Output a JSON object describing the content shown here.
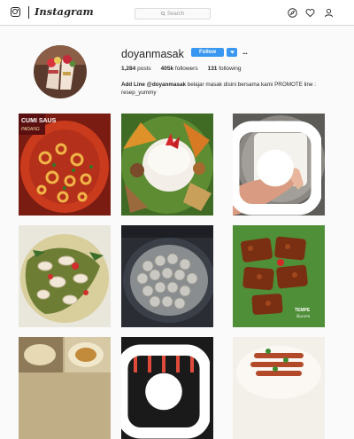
{
  "topbar": {
    "brand": "Instagram",
    "search_placeholder": "Search"
  },
  "profile": {
    "username": "doyanmasak",
    "follow_label": "Follow",
    "more_label": "...",
    "stats": {
      "posts_count": "1,284",
      "posts_label": "posts",
      "followers_count": "405k",
      "followers_label": "followers",
      "following_count": "131",
      "following_label": "following"
    },
    "bio_name": "Add Line @doyanmasak",
    "bio_text": "belajar masak disini bersama kami PROMOTE line : resep_yummy"
  },
  "posts": {
    "tile_1_caption": "CUMI SAUS",
    "tile_1_caption_2": "PADANG",
    "tile_6_caption": "TEMPE",
    "tile_6_caption_2": "Bacem"
  },
  "colors": {
    "accent": "#3897f0",
    "border": "#dbdbdb",
    "background": "#fafafa"
  }
}
